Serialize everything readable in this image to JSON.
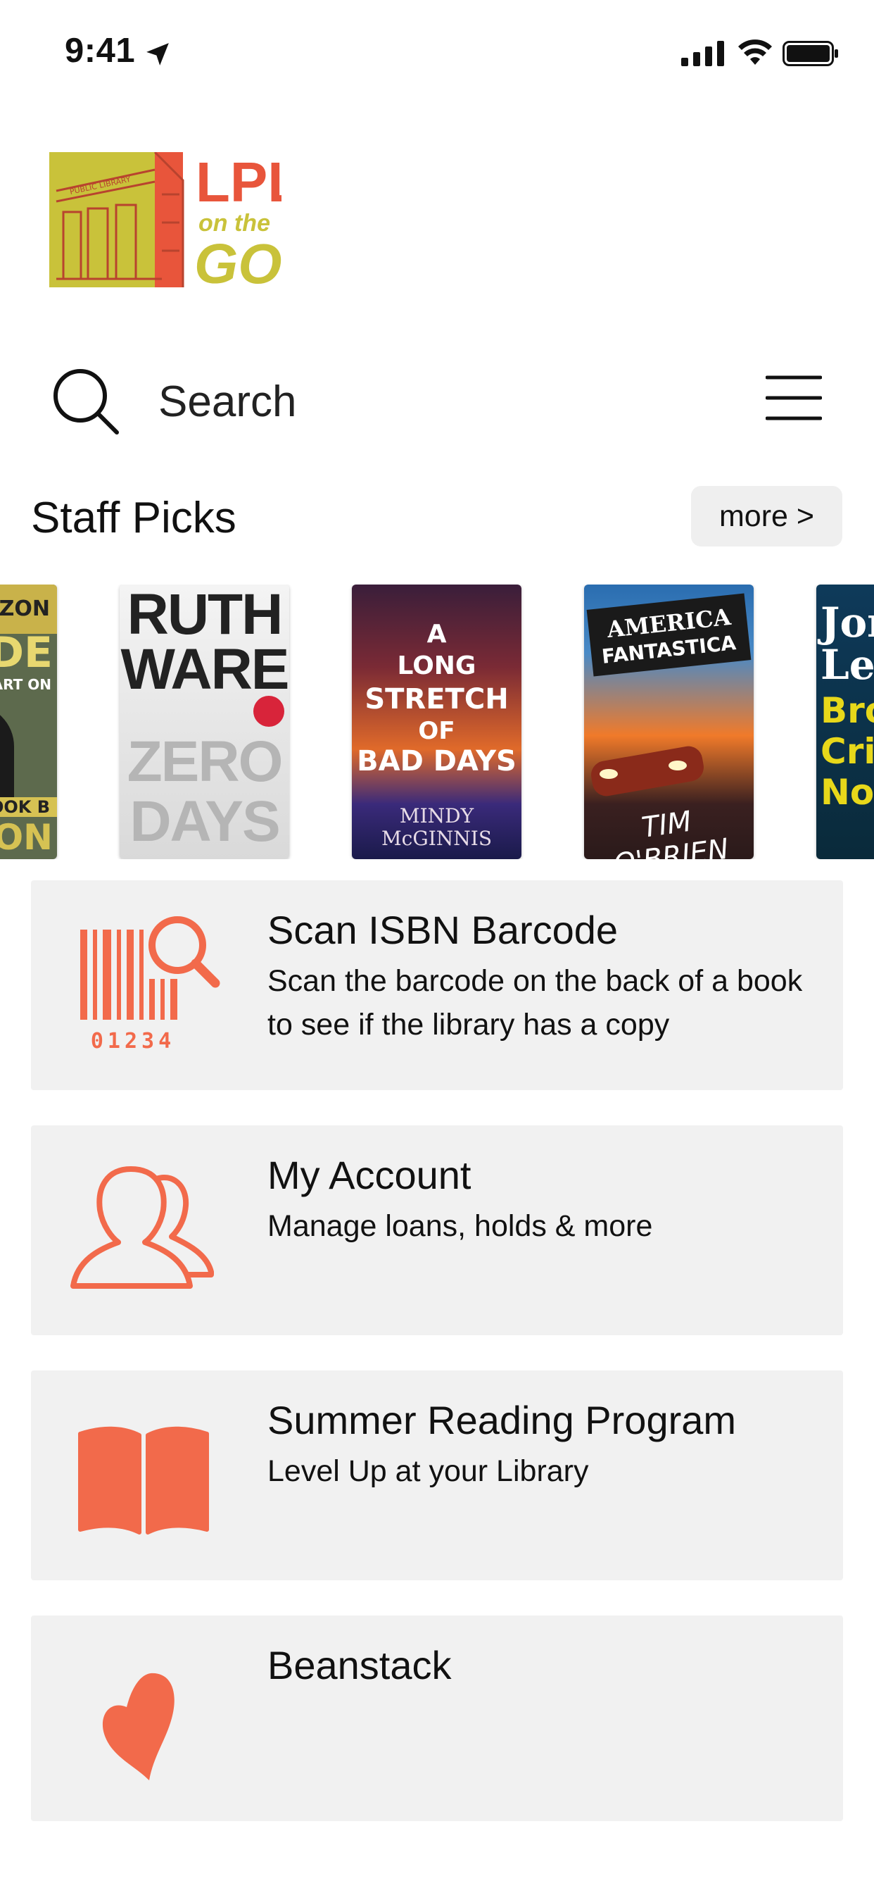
{
  "status_bar": {
    "time": "9:41"
  },
  "logo": {
    "line1": "LPL",
    "line2": "on the",
    "line3": "GO",
    "building_text": "PUBLIC LIBRARY"
  },
  "search": {
    "label": "Search"
  },
  "staff_picks": {
    "title": "Staff Picks",
    "more_label": "more >",
    "books": [
      {
        "cover_lines": [
          "ARZON",
          "CIDE",
          "PART ON",
          "BOOK B",
          "MON"
        ]
      },
      {
        "cover_lines": [
          "RUTH",
          "WARE",
          "ZERO",
          "DAYS"
        ]
      },
      {
        "cover_lines": [
          "A",
          "LONG",
          "STRETCH",
          "OF",
          "BAD DAYS",
          "MINDY",
          "McGINNIS"
        ]
      },
      {
        "cover_lines": [
          "AMERICA",
          "FANTASTICA",
          "TIM O'BRIEN"
        ]
      },
      {
        "cover_lines": [
          "Jon",
          "Let",
          "Bro",
          "Cri",
          "Nov"
        ]
      }
    ]
  },
  "cards": [
    {
      "title": "Scan ISBN Barcode",
      "description": "Scan the barcode on the back of a book to see if the library has a copy",
      "icon": "barcode-search-icon",
      "barcode_digits": "01234"
    },
    {
      "title": "My Account",
      "description": "Manage loans, holds & more",
      "icon": "users-icon"
    },
    {
      "title": "Summer Reading Program",
      "description": "Level Up at your Library",
      "icon": "book-icon"
    },
    {
      "title": "Beanstack",
      "description": "",
      "icon": "heart-icon"
    }
  ],
  "colors": {
    "accent": "#F26A4B",
    "card_bg": "#F1F1F1",
    "logo_yellow": "#C9C23A",
    "logo_red": "#E8553B"
  }
}
